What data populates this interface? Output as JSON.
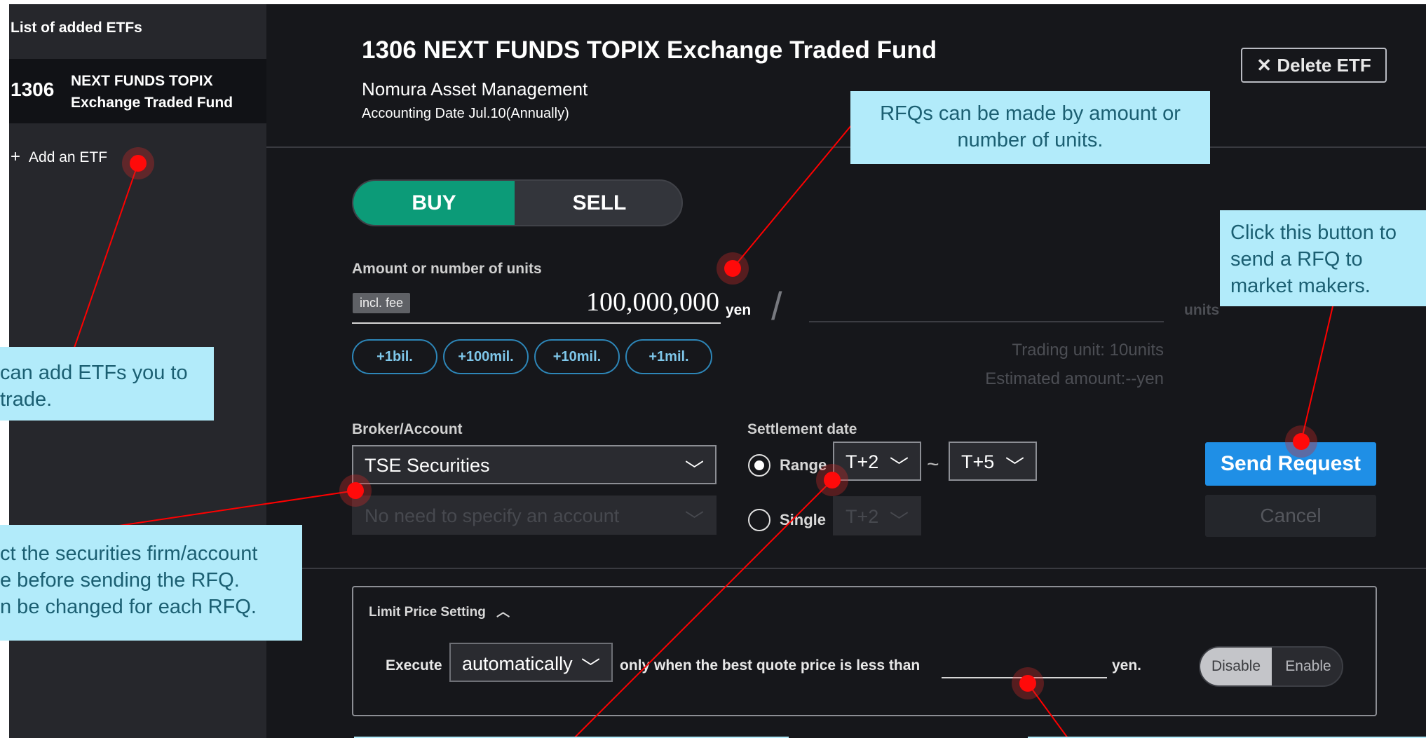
{
  "sidebar": {
    "title": "List of added ETFs",
    "items": [
      {
        "code": "1306",
        "name": "NEXT FUNDS TOPIX Exchange Traded Fund"
      }
    ],
    "add_label": "Add an ETF"
  },
  "header": {
    "title": "1306 NEXT FUNDS TOPIX Exchange Traded Fund",
    "manager": "Nomura Asset Management",
    "accounting_date": "Accounting Date Jul.10(Annually)",
    "delete_label": "Delete ETF"
  },
  "trade": {
    "buy_label": "BUY",
    "sell_label": "SELL",
    "selected_side": "BUY",
    "amount_label": "Amount or number of units",
    "incl_fee": "incl. fee",
    "amount_value": "100,000,000",
    "amount_unit": "yen",
    "units_unit": "units",
    "trading_unit": "Trading unit: 10units",
    "estimated_amount": "Estimated amount:--yen",
    "quick_add": [
      "+1bil.",
      "+100mil.",
      "+10mil.",
      "+1mil."
    ]
  },
  "broker": {
    "label": "Broker/Account",
    "value": "TSE Securities",
    "account_placeholder": "No need to specify an account"
  },
  "settlement": {
    "label": "Settlement date",
    "range_label": "Range",
    "single_label": "Single",
    "range_from": "T+2",
    "range_to": "T+5",
    "single_value": "T+2",
    "selected": "Range"
  },
  "actions": {
    "send_label": "Send Request",
    "cancel_label": "Cancel"
  },
  "limit": {
    "title": "Limit Price Setting",
    "execute_label": "Execute",
    "mode_value": "automatically",
    "condition_text": "only when the best quote price is less than",
    "unit": "yen.",
    "disable_label": "Disable",
    "enable_label": "Enable",
    "state": "Disable"
  },
  "annotations": {
    "rfq_amount": "RFQs can be made by amount or number of units.",
    "send_request": "Click this button to send a RFQ to market makers.",
    "add_etf": "can add ETFs you to trade.",
    "broker_line1": "ct the securities firm/account",
    "broker_line2": "e before sending the RFQ.",
    "broker_line3": "n be changed for each RFQ."
  },
  "colors": {
    "buy_green": "#0c9b78",
    "send_blue": "#1f8fe6",
    "callout_bg": "#b2ebfa",
    "marker_red": "#ff0a0a"
  }
}
